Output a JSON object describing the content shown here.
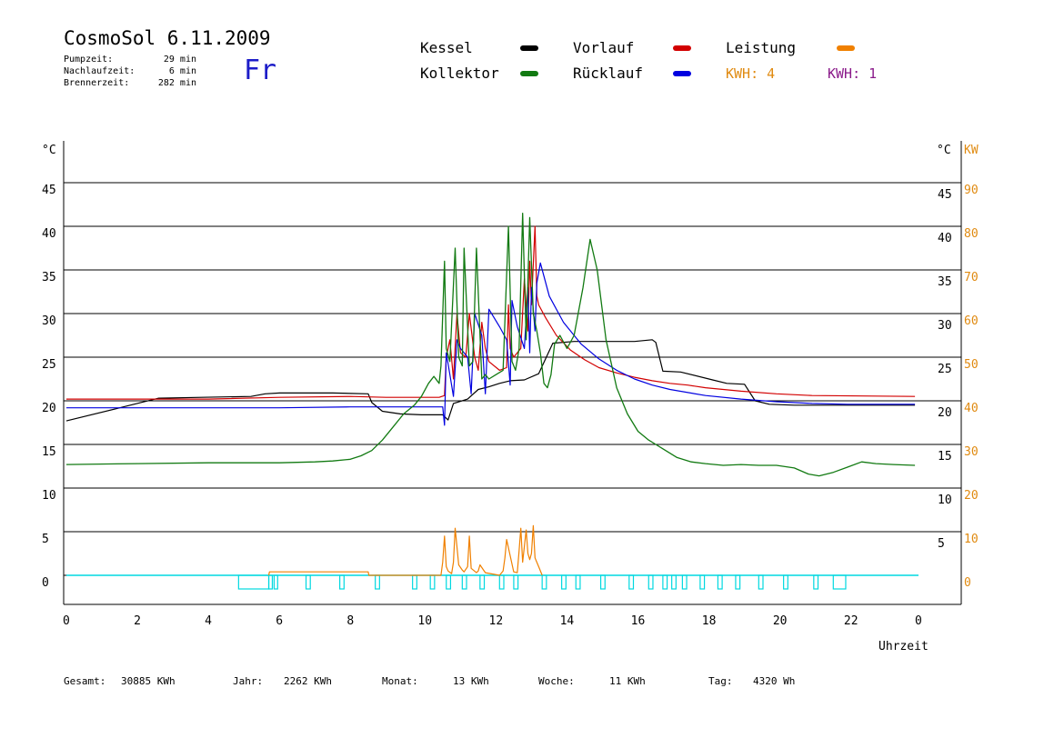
{
  "header": {
    "title": "CosmoSol 6.11.2009",
    "day": "Fr",
    "info": [
      {
        "label": "Pumpzeit:",
        "value": "29 min"
      },
      {
        "label": "Nachlaufzeit:",
        "value": "6 min"
      },
      {
        "label": "Brennerzeit:",
        "value": "282 min"
      }
    ]
  },
  "legend": [
    {
      "name": "Kessel",
      "color": "#000000"
    },
    {
      "name": "Kollektor",
      "color": "#127a12"
    },
    {
      "name": "Vorlauf",
      "color": "#d20000"
    },
    {
      "name": "Rücklauf",
      "color": "#0000e0"
    },
    {
      "name": "Leistung",
      "color": "#f08000"
    }
  ],
  "kwh": [
    {
      "text": "KWH: 4",
      "color": "#e08a10"
    },
    {
      "text": "KWH: 1",
      "color": "#8a1a8a"
    }
  ],
  "footer": [
    {
      "label": "Gesamt:",
      "value": "30885 KWh"
    },
    {
      "label": "Jahr:",
      "value": "2262 KWh"
    },
    {
      "label": "Monat:",
      "value": "13 KWh"
    },
    {
      "label": "Woche:",
      "value": "11 KWh"
    },
    {
      "label": "Tag:",
      "value": "4320 Wh"
    }
  ],
  "chart_data": {
    "type": "line",
    "xlabel": "Uhrzeit",
    "ylabel_left": "°C",
    "ylabel_right_1": "°C",
    "ylabel_right_2": "KW",
    "xlim": [
      0,
      24
    ],
    "ylim": [
      0,
      50
    ],
    "x_ticks": [
      "0",
      "2",
      "4",
      "6",
      "8",
      "10",
      "12",
      "14",
      "16",
      "18",
      "20",
      "22",
      "0"
    ],
    "y_ticks_left": [
      "0",
      "5",
      "10",
      "15",
      "20",
      "25",
      "30",
      "35",
      "40",
      "45"
    ],
    "y_ticks_right_temp": [
      "5",
      "10",
      "15",
      "20",
      "25",
      "30",
      "35",
      "40",
      "45"
    ],
    "y_ticks_right_kw": [
      "0",
      "10",
      "20",
      "30",
      "40",
      "50",
      "60",
      "70",
      "80",
      "90"
    ],
    "grid": true,
    "series": [
      {
        "name": "Kessel",
        "color": "#000000",
        "x": [
          0,
          1.5,
          2.6,
          3.8,
          5.2,
          5.6,
          6,
          7.5,
          8.5,
          8.6,
          8.9,
          9.4,
          10,
          10.6,
          10.75,
          10.9,
          11.3,
          11.6,
          11.9,
          12.2,
          12.5,
          12.9,
          13.3,
          13.7,
          14.3,
          15.5,
          16,
          16.5,
          16.6,
          16.8,
          17.3,
          18.2,
          18.6,
          19.1,
          19.4,
          19.8,
          20.5,
          23.9
        ],
        "y": [
          17.7,
          19.2,
          20.3,
          20.4,
          20.5,
          20.8,
          20.9,
          20.9,
          20.8,
          19.8,
          18.8,
          18.5,
          18.4,
          18.4,
          17.8,
          19.7,
          20.2,
          21.3,
          21.6,
          22,
          22.3,
          22.4,
          23.1,
          26.6,
          26.8,
          26.8,
          26.8,
          27,
          26.7,
          23.4,
          23.3,
          22.4,
          22,
          21.9,
          20,
          19.6,
          19.5,
          19.5
        ]
      },
      {
        "name": "Vorlauf",
        "color": "#d20000",
        "x": [
          0,
          4,
          6,
          8,
          9,
          10.5,
          10.65,
          10.7,
          10.8,
          10.9,
          11,
          11.1,
          11.25,
          11.35,
          11.5,
          11.6,
          11.7,
          11.8,
          11.9,
          12.2,
          12.4,
          12.45,
          12.5,
          12.6,
          12.8,
          12.9,
          13,
          13.05,
          13.1,
          13.2,
          13.25,
          13.3,
          13.5,
          13.8,
          14.2,
          14.6,
          15,
          15.5,
          16,
          16.5,
          17,
          17.5,
          18,
          19,
          20,
          21,
          23.9
        ],
        "y": [
          20.2,
          20.2,
          20.4,
          20.5,
          20.4,
          20.4,
          20.6,
          25,
          27,
          22.5,
          30,
          25.5,
          25,
          30,
          25,
          23.5,
          29,
          26,
          24.5,
          23.5,
          23.8,
          31,
          26,
          25,
          26,
          34,
          28,
          36,
          31,
          40,
          32,
          31,
          29.5,
          27.5,
          25.8,
          24.7,
          23.8,
          23.2,
          22.7,
          22.3,
          22,
          21.8,
          21.5,
          21.1,
          20.8,
          20.6,
          20.5
        ]
      },
      {
        "name": "Rücklauf",
        "color": "#0000e0",
        "x": [
          0,
          4,
          6,
          8,
          9,
          10,
          10.6,
          10.65,
          10.7,
          10.8,
          10.9,
          11,
          11.1,
          11.3,
          11.4,
          11.5,
          11.7,
          11.8,
          11.9,
          12.2,
          12.4,
          12.5,
          12.55,
          12.7,
          12.9,
          13,
          13.05,
          13.1,
          13.2,
          13.25,
          13.35,
          13.6,
          14,
          14.5,
          15,
          15.5,
          16,
          16.5,
          17,
          18,
          19,
          20,
          21,
          22,
          23.9
        ],
        "y": [
          19.2,
          19.2,
          19.2,
          19.3,
          19.3,
          19.3,
          19.3,
          17.2,
          25.5,
          23,
          20.5,
          27,
          26,
          25,
          20.8,
          30,
          27.5,
          20.8,
          30.5,
          28.5,
          27,
          21.8,
          31.5,
          28.5,
          26,
          33,
          25.5,
          33,
          28,
          33.5,
          35.8,
          32,
          29,
          26.5,
          24.8,
          23.5,
          22.5,
          21.8,
          21.3,
          20.6,
          20.2,
          19.9,
          19.7,
          19.6,
          19.6
        ]
      },
      {
        "name": "Kollektor",
        "color": "#127a12",
        "x": [
          0,
          2,
          4,
          6,
          7,
          7.5,
          8,
          8.3,
          8.6,
          8.9,
          9.2,
          9.5,
          9.8,
          10,
          10.2,
          10.35,
          10.5,
          10.55,
          10.65,
          10.7,
          10.8,
          10.95,
          11.05,
          11.15,
          11.2,
          11.35,
          11.45,
          11.55,
          11.7,
          11.8,
          11.9,
          12.1,
          12.3,
          12.45,
          12.55,
          12.65,
          12.75,
          12.85,
          12.95,
          13.05,
          13.15,
          13.25,
          13.35,
          13.45,
          13.55,
          13.65,
          13.75,
          13.9,
          14.1,
          14.3,
          14.55,
          14.75,
          14.95,
          15.2,
          15.5,
          15.8,
          16.1,
          16.4,
          16.6,
          16.8,
          17.2,
          17.6,
          18,
          18.5,
          19,
          19.5,
          20,
          20.5,
          20.9,
          21.2,
          21.6,
          22,
          22.4,
          22.8,
          23.3,
          23.9
        ],
        "y": [
          12.7,
          12.8,
          12.9,
          12.9,
          13,
          13.1,
          13.3,
          13.7,
          14.3,
          15.5,
          17,
          18.5,
          19.5,
          20.5,
          22,
          22.8,
          22,
          24,
          36,
          26,
          24.5,
          37.5,
          25,
          24,
          37.5,
          24,
          24.5,
          37.5,
          22.5,
          23,
          22.5,
          23,
          23.5,
          40,
          24.5,
          23.5,
          26,
          41.5,
          27,
          41,
          30,
          28,
          25.5,
          22,
          21.5,
          23,
          26.5,
          27.5,
          26,
          27.5,
          33,
          38.5,
          35,
          27,
          21.5,
          18.5,
          16.5,
          15.5,
          15,
          14.5,
          13.5,
          13,
          12.8,
          12.6,
          12.7,
          12.6,
          12.6,
          12.3,
          11.6,
          11.4,
          11.8,
          12.4,
          13,
          12.8,
          12.7,
          12.6
        ]
      },
      {
        "name": "Leistung",
        "color": "#f08000",
        "x": [
          5.7,
          5.72,
          8.5,
          8.52,
          10.55,
          10.6,
          10.65,
          10.7,
          10.75,
          10.85,
          10.9,
          10.95,
          11.05,
          11.15,
          11.2,
          11.3,
          11.35,
          11.4,
          11.55,
          11.6,
          11.65,
          11.8,
          12.2,
          12.3,
          12.35,
          12.4,
          12.6,
          12.7,
          12.75,
          12.8,
          12.85,
          12.95,
          13,
          13.05,
          13.1,
          13.15,
          13.2,
          13.25,
          13.3,
          13.4
        ],
        "y": [
          0,
          0.4,
          0.4,
          0,
          0,
          1.5,
          4.5,
          1,
          0.5,
          0.2,
          1.5,
          5.4,
          1.2,
          0.6,
          0.4,
          1,
          4.5,
          0.8,
          0.3,
          0.5,
          1.2,
          0.3,
          0,
          0.5,
          2,
          4.1,
          0.4,
          0.3,
          2.8,
          5.4,
          1.5,
          5.2,
          2.5,
          1.8,
          2.5,
          5.7,
          2,
          1.5,
          1,
          0
        ]
      },
      {
        "name": "Pumpe",
        "color": "#00d8e0",
        "x": [
          4.85,
          5.7,
          5.85,
          6.75,
          7.7,
          8.7,
          9.75,
          10.25,
          10.7,
          11.15,
          11.65,
          12.2,
          12.6,
          13.4,
          13.95,
          14.35,
          15.05,
          15.85,
          16.4,
          16.8,
          17.05,
          17.35,
          17.85,
          18.35,
          18.85,
          19.5,
          20.2,
          21.05,
          21.6
        ],
        "w": [
          0.85,
          0.1,
          0.1,
          0.12,
          0.12,
          0.12,
          0.12,
          0.12,
          0.12,
          0.12,
          0.12,
          0.12,
          0.12,
          0.12,
          0.12,
          0.12,
          0.12,
          0.12,
          0.12,
          0.12,
          0.12,
          0.12,
          0.12,
          0.12,
          0.12,
          0.12,
          0.12,
          0.12,
          0.35
        ]
      }
    ]
  }
}
